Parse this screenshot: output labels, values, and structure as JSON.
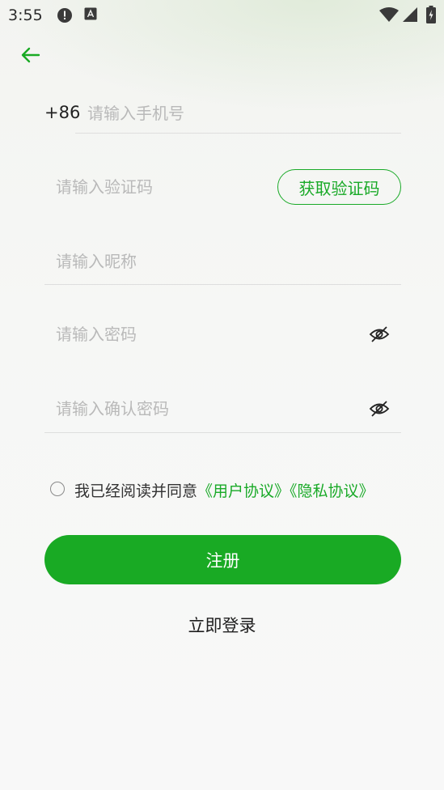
{
  "status_bar": {
    "time": "3:55",
    "icons": [
      "alert-icon",
      "a-icon",
      "wifi-icon",
      "signal-icon",
      "battery-icon"
    ]
  },
  "header": {
    "back_icon": "arrow-left-icon"
  },
  "form": {
    "phone": {
      "country_code": "+86",
      "placeholder": "请输入手机号"
    },
    "code": {
      "placeholder": "请输入验证码",
      "button_label": "获取验证码"
    },
    "nickname": {
      "placeholder": "请输入昵称"
    },
    "password": {
      "placeholder": "请输入密码",
      "toggle_icon": "eye-off-icon"
    },
    "confirm_password": {
      "placeholder": "请输入确认密码",
      "toggle_icon": "eye-off-icon"
    }
  },
  "agreement": {
    "text": "我已经阅读并同意",
    "user_agreement": "《用户协议》",
    "privacy_agreement": "《隐私协议》",
    "checked": false
  },
  "actions": {
    "register_label": "注册",
    "login_label": "立即登录"
  },
  "colors": {
    "accent": "#19aa24",
    "placeholder": "#b9b9b9",
    "divider": "#dedede"
  }
}
